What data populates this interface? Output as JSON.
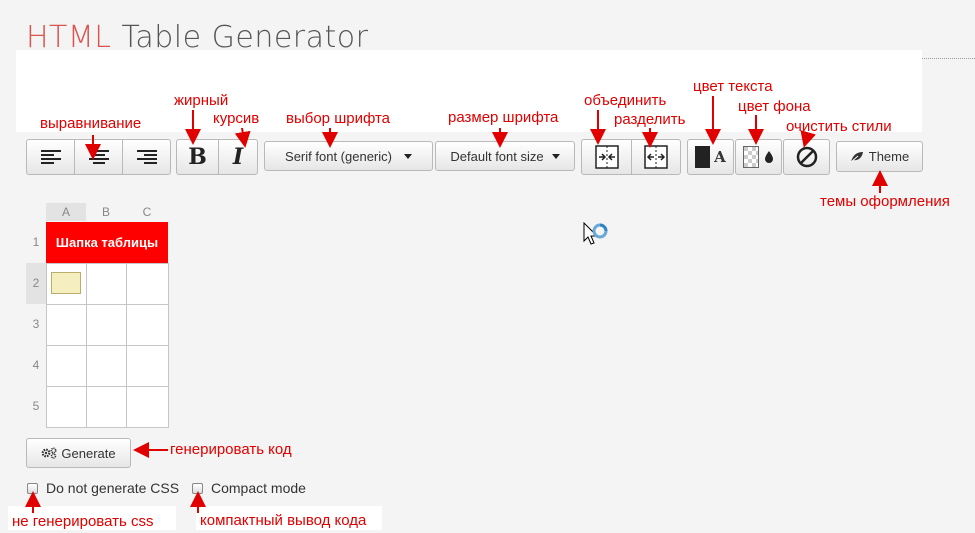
{
  "title": {
    "part1": "HTML",
    "part2": " Table Generator"
  },
  "toolbar": {
    "font_select": "Serif font (generic)",
    "size_select": "Default font size",
    "bold": "B",
    "italic": "I",
    "text_color_letter": "A",
    "theme": "Theme"
  },
  "grid": {
    "columns": [
      "A",
      "B",
      "C"
    ],
    "rows": [
      "1",
      "2",
      "3",
      "4",
      "5"
    ],
    "header_cell": "Шапка таблицы",
    "header_color": "#ff0000",
    "selected_cell_color": "#f5efc0"
  },
  "generate_label": "Generate",
  "options": {
    "no_css": "Do not generate CSS",
    "compact": "Compact mode"
  },
  "annotations": {
    "align": "выравнивание",
    "bold": "жирный",
    "italic": "курсив",
    "font": "выбор шрифта",
    "size": "размер шрифта",
    "merge": "объединить",
    "split": "разделить",
    "text_color": "цвет текста",
    "bg_color": "цвет фона",
    "clear": "очистить стили",
    "themes": "темы оформления",
    "generate": "генерировать код",
    "no_css": "не генерировать css",
    "compact": "компактный вывод кода",
    "color": "#e00000"
  }
}
